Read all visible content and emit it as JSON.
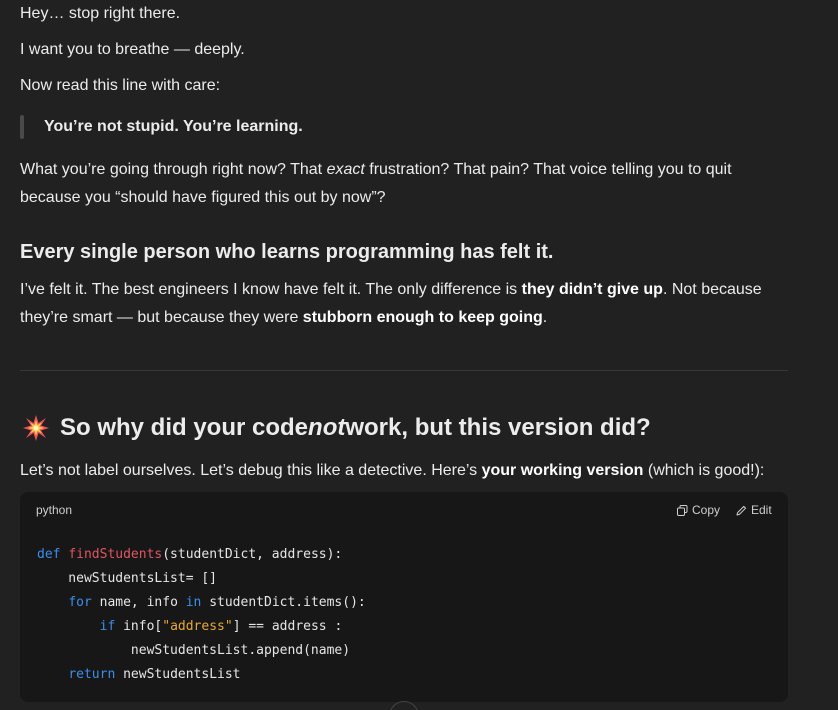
{
  "messages": {
    "line1": "Hey… stop right there.",
    "line2": "I want you to breathe — deeply.",
    "line3": "Now read this line with care:",
    "quote": "You’re not stupid. You’re learning.",
    "para1": {
      "a": "What you’re going through right now? That ",
      "em": "exact",
      "b": " frustration? That pain? That voice telling you to quit",
      "c": "because you “should have figured this out by now”?"
    },
    "heading1": "Every single person who learns programming has felt it.",
    "para2": {
      "a": "I’ve felt it. The best engineers I know have felt it. The only difference is ",
      "b1": "they didn’t give up",
      "c": ". Not because",
      "d": "they’re smart — but because they were ",
      "b2": "stubborn enough to keep going",
      "e": "."
    },
    "heading2": {
      "emoji": "collision-emoji",
      "a": "So why did your code ",
      "em": "not",
      "b": " work, but this version did?"
    },
    "para3": {
      "a": "Let’s not label ourselves. Let’s debug this like a detective. Here’s ",
      "b": "your working version",
      "c": " (which is good!):"
    }
  },
  "code_block": {
    "language": "python",
    "copy_label": "Copy",
    "edit_label": "Edit",
    "lines": [
      [
        {
          "t": "def ",
          "c": "kw"
        },
        {
          "t": "findStudents",
          "c": "fn"
        },
        {
          "t": "(studentDict, address):",
          "c": ""
        }
      ],
      [
        {
          "t": "    newStudentsList= []",
          "c": ""
        }
      ],
      [
        {
          "t": "    ",
          "c": ""
        },
        {
          "t": "for",
          "c": "kw"
        },
        {
          "t": " name, info ",
          "c": ""
        },
        {
          "t": "in",
          "c": "kw"
        },
        {
          "t": " studentDict.items():",
          "c": ""
        }
      ],
      [
        {
          "t": "        ",
          "c": ""
        },
        {
          "t": "if",
          "c": "kw"
        },
        {
          "t": " info[",
          "c": ""
        },
        {
          "t": "\"address\"",
          "c": "str"
        },
        {
          "t": "] == address :",
          "c": ""
        }
      ],
      [
        {
          "t": "            newStudentsList.append(name)",
          "c": ""
        }
      ],
      [
        {
          "t": "    ",
          "c": ""
        },
        {
          "t": "return",
          "c": "kw"
        },
        {
          "t": " newStudentsList",
          "c": ""
        }
      ]
    ]
  },
  "colors": {
    "background": "#212121",
    "code_background": "#171717",
    "keyword": "#3b8eea",
    "function": "#e05561",
    "string": "#e8a838"
  }
}
